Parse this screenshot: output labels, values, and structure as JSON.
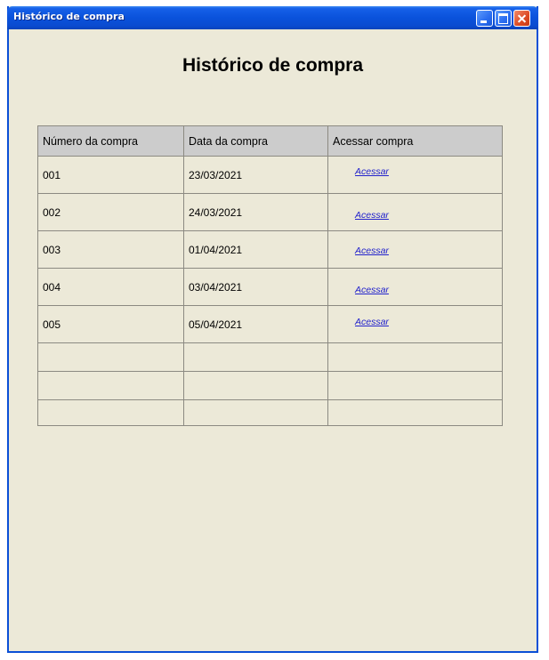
{
  "window": {
    "title": "Histórico de compra"
  },
  "page": {
    "heading": "Histórico de compra"
  },
  "table": {
    "headers": [
      "Número da compra",
      "Data da compra",
      "Acessar compra"
    ],
    "rows": [
      {
        "number": "001",
        "date": "23/03/2021",
        "action": "Acessar"
      },
      {
        "number": "002",
        "date": "24/03/2021",
        "action": "Acessar"
      },
      {
        "number": "003",
        "date": "01/04/2021",
        "action": "Acessar"
      },
      {
        "number": "004",
        "date": "03/04/2021",
        "action": "Acessar"
      },
      {
        "number": "005",
        "date": "05/04/2021",
        "action": "Acessar"
      }
    ]
  },
  "colors": {
    "titlebar": "#0a52db",
    "window_background": "#ece9d8",
    "header_background": "#cccccc",
    "link": "#2222cc"
  }
}
